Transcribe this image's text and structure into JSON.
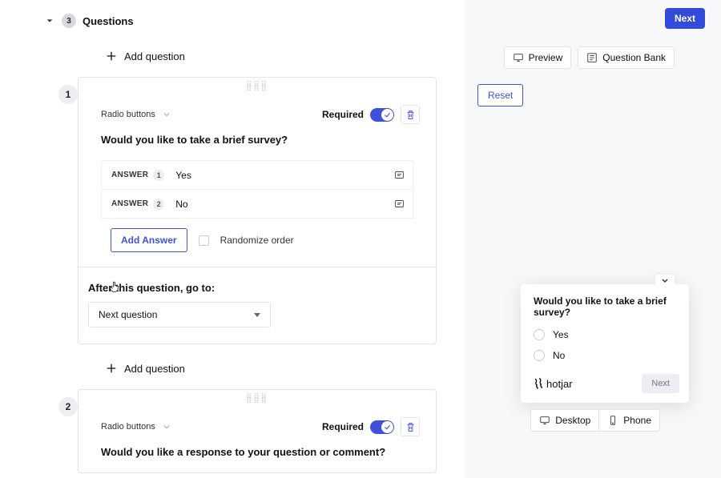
{
  "header": {
    "step_badge": "3",
    "title": "Questions"
  },
  "buttons": {
    "next": "Next",
    "add_question": "Add question",
    "add_answer": "Add Answer",
    "preview": "Preview",
    "question_bank": "Question Bank",
    "reset": "Reset",
    "desktop": "Desktop",
    "phone": "Phone",
    "widget_next": "Next"
  },
  "labels": {
    "required": "Required",
    "randomize": "Randomize order",
    "after_this": "After this question, go to:",
    "answer": "ANSWER"
  },
  "questions": [
    {
      "num": "1",
      "type": "Radio buttons",
      "text": "Would you like to take a brief survey?",
      "answers": [
        {
          "n": "1",
          "text": "Yes"
        },
        {
          "n": "2",
          "text": "No"
        }
      ],
      "goto": "Next question"
    },
    {
      "num": "2",
      "type": "Radio buttons",
      "text": "Would you like a response to your question or comment?"
    }
  ],
  "preview": {
    "question": "Would you like to take a brief survey?",
    "options": [
      "Yes",
      "No"
    ],
    "brand": "hotjar"
  }
}
